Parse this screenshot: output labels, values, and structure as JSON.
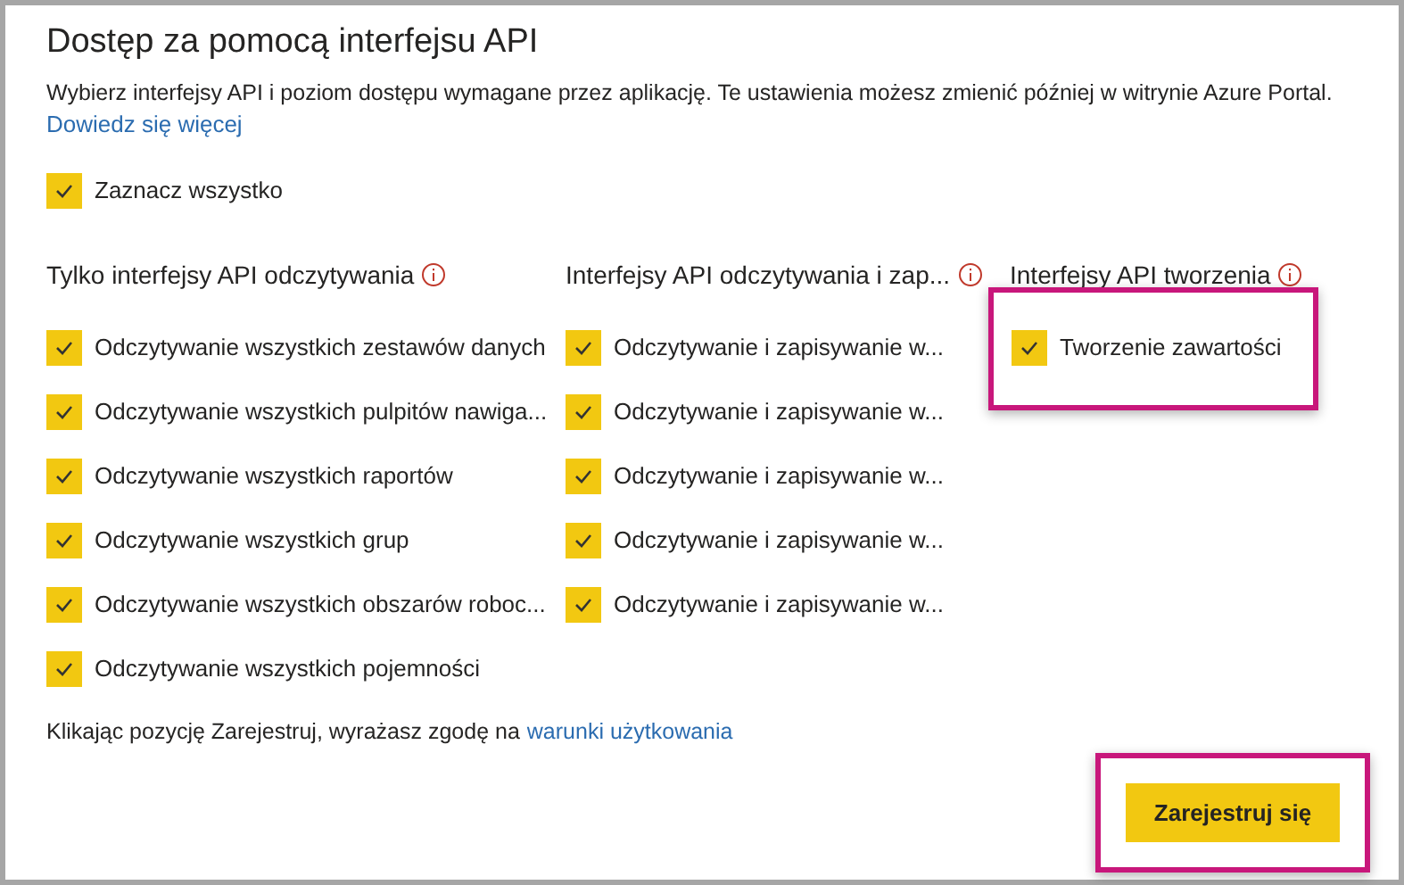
{
  "title": "Dostęp za pomocą interfejsu API",
  "description": "Wybierz interfejsy API i poziom dostępu wymagane przez aplikację. Te ustawienia możesz zmienić później w witrynie Azure Portal.",
  "learn_more_link": "Dowiedz się więcej",
  "select_all": {
    "label": "Zaznacz wszystko",
    "checked": true
  },
  "columns": [
    {
      "heading": "Tylko interfejsy API odczytywania",
      "highlighted": false,
      "items": [
        {
          "label": "Odczytywanie wszystkich zestawów danych",
          "checked": true
        },
        {
          "label": "Odczytywanie wszystkich pulpitów nawiga...",
          "checked": true
        },
        {
          "label": "Odczytywanie wszystkich raportów",
          "checked": true
        },
        {
          "label": "Odczytywanie wszystkich grup",
          "checked": true
        },
        {
          "label": "Odczytywanie wszystkich obszarów roboc...",
          "checked": true
        },
        {
          "label": "Odczytywanie wszystkich pojemności",
          "checked": true
        }
      ]
    },
    {
      "heading": "Interfejsy API odczytywania i zap...",
      "highlighted": false,
      "items": [
        {
          "label": "Odczytywanie i zapisywanie w...",
          "checked": true
        },
        {
          "label": "Odczytywanie i zapisywanie w...",
          "checked": true
        },
        {
          "label": "Odczytywanie i zapisywanie w...",
          "checked": true
        },
        {
          "label": "Odczytywanie i zapisywanie w...",
          "checked": true
        },
        {
          "label": "Odczytywanie i zapisywanie w...",
          "checked": true
        }
      ]
    },
    {
      "heading": "Interfejsy API tworzenia",
      "highlighted": true,
      "items": [
        {
          "label": "Tworzenie zawartości",
          "checked": true
        }
      ]
    }
  ],
  "terms": {
    "text": "Klikając pozycję Zarejestruj, wyrażasz zgodę na",
    "link": "warunki użytkowania"
  },
  "register_button": {
    "label": "Zarejestruj się",
    "highlighted": true
  }
}
